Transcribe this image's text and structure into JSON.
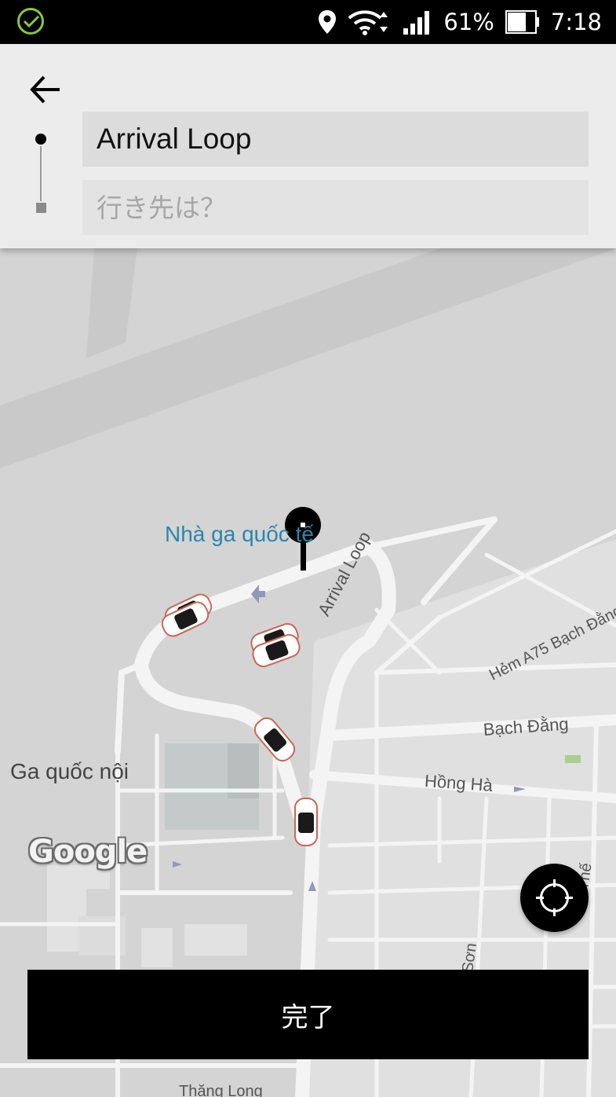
{
  "status_bar": {
    "battery_percent": "61%",
    "time": "7:18",
    "icons": [
      "check-circle-icon",
      "location-pin-icon",
      "wifi-icon",
      "signal-icon",
      "battery-icon"
    ]
  },
  "search_panel": {
    "pickup_value": "Arrival Loop",
    "destination_placeholder": "行き先は？",
    "destination_value": ""
  },
  "map": {
    "labels": {
      "poi_terminal": "Nhà ga quốc tế",
      "domestic_terminal": "Ga quốc nội",
      "arrival_loop": "Arrival Loop",
      "alley_a75": "Hẻm A75 Bạch Đằng",
      "bach_dang": "Bạch Đằng",
      "hong_ha": "Hồng Hà",
      "son_street": "Sơn",
      "the_street": "Thế",
      "thang_street": "Thăng Long"
    },
    "attribution": "Google",
    "colors": {
      "background": "#d4d4d4",
      "road": "#f4f4f4",
      "poi": "#2a86ad"
    }
  },
  "actions": {
    "done_label": "完了",
    "locate_icon": "crosshair-icon"
  }
}
